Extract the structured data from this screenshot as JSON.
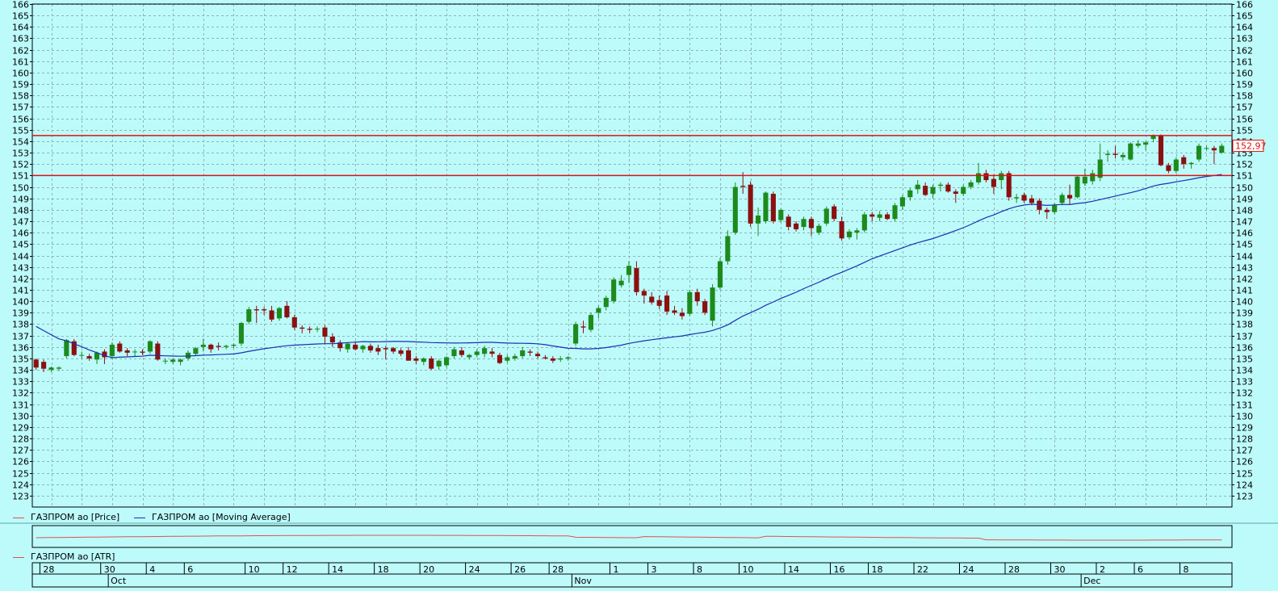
{
  "legend": {
    "price": "ГАЗПРОМ ао [Price]",
    "ma": "ГАЗПРОМ ао [Moving Average]",
    "atr": "ГАЗПРОМ ао [ATR]"
  },
  "colors": {
    "background": "#bdfbfb",
    "up": "#1c8b1c",
    "down": "#8b1010",
    "ma": "#1c2fb0",
    "level": "#e01010",
    "atr": "#e05050"
  },
  "chart_data": {
    "type": "candlestick",
    "ylim": [
      122,
      166
    ],
    "ticks": [
      123,
      124,
      125,
      126,
      127,
      128,
      129,
      130,
      131,
      132,
      133,
      134,
      135,
      136,
      137,
      138,
      139,
      140,
      141,
      142,
      143,
      144,
      145,
      146,
      147,
      148,
      149,
      150,
      151,
      152,
      153,
      154,
      155,
      156,
      157,
      158,
      159,
      160,
      161,
      162,
      163,
      164,
      165,
      166
    ],
    "last_price": "152,97",
    "levels": [
      154.5,
      151.0
    ],
    "x_day_labels": [
      "28",
      "30",
      "4",
      "6",
      "10",
      "12",
      "14",
      "18",
      "20",
      "24",
      "26",
      "28",
      "1",
      "3",
      "8",
      "10",
      "14",
      "16",
      "18",
      "22",
      "24",
      "28",
      "30",
      "2",
      "6",
      "8"
    ],
    "x_month_labels": [
      "Oct",
      "Nov",
      "Dec"
    ],
    "candles": [
      {
        "o": 134.9,
        "h": 135.0,
        "l": 134.0,
        "c": 134.2
      },
      {
        "o": 134.7,
        "h": 134.9,
        "l": 133.8,
        "c": 134.1
      },
      {
        "o": 134.0,
        "h": 134.3,
        "l": 133.8,
        "c": 134.2
      },
      {
        "o": 134.1,
        "h": 134.3,
        "l": 133.9,
        "c": 134.2
      },
      {
        "o": 135.2,
        "h": 136.7,
        "l": 135.0,
        "c": 136.6
      },
      {
        "o": 136.5,
        "h": 136.7,
        "l": 135.2,
        "c": 135.3
      },
      {
        "o": 135.3,
        "h": 135.6,
        "l": 135.0,
        "c": 135.3
      },
      {
        "o": 135.2,
        "h": 135.4,
        "l": 134.8,
        "c": 135.0
      },
      {
        "o": 134.9,
        "h": 135.6,
        "l": 134.5,
        "c": 135.5
      },
      {
        "o": 135.6,
        "h": 135.8,
        "l": 134.5,
        "c": 135.1
      },
      {
        "o": 135.2,
        "h": 136.4,
        "l": 135.0,
        "c": 136.2
      },
      {
        "o": 136.3,
        "h": 136.5,
        "l": 135.5,
        "c": 135.6
      },
      {
        "o": 135.7,
        "h": 135.9,
        "l": 135.2,
        "c": 135.5
      },
      {
        "o": 135.6,
        "h": 135.8,
        "l": 135.2,
        "c": 135.6
      },
      {
        "o": 135.6,
        "h": 135.8,
        "l": 135.3,
        "c": 135.5
      },
      {
        "o": 135.6,
        "h": 136.6,
        "l": 135.4,
        "c": 136.5
      },
      {
        "o": 136.3,
        "h": 136.5,
        "l": 134.8,
        "c": 134.9
      },
      {
        "o": 134.8,
        "h": 135.0,
        "l": 134.5,
        "c": 134.8
      },
      {
        "o": 134.7,
        "h": 135.0,
        "l": 134.5,
        "c": 134.9
      },
      {
        "o": 134.7,
        "h": 135.0,
        "l": 134.4,
        "c": 134.9
      },
      {
        "o": 135.0,
        "h": 135.7,
        "l": 134.8,
        "c": 135.5
      },
      {
        "o": 135.4,
        "h": 136.0,
        "l": 135.2,
        "c": 135.9
      },
      {
        "o": 136.0,
        "h": 136.7,
        "l": 135.6,
        "c": 136.2
      },
      {
        "o": 136.2,
        "h": 136.3,
        "l": 135.5,
        "c": 135.8
      },
      {
        "o": 136.1,
        "h": 136.4,
        "l": 135.7,
        "c": 136.0
      },
      {
        "o": 136.0,
        "h": 136.2,
        "l": 135.8,
        "c": 136.1
      },
      {
        "o": 136.1,
        "h": 136.3,
        "l": 135.9,
        "c": 136.2
      },
      {
        "o": 136.3,
        "h": 138.2,
        "l": 136.1,
        "c": 138.1
      },
      {
        "o": 138.2,
        "h": 139.5,
        "l": 138.0,
        "c": 139.3
      },
      {
        "o": 139.3,
        "h": 139.6,
        "l": 138.1,
        "c": 139.2
      },
      {
        "o": 139.3,
        "h": 139.5,
        "l": 138.8,
        "c": 139.2
      },
      {
        "o": 139.2,
        "h": 139.6,
        "l": 138.2,
        "c": 138.4
      },
      {
        "o": 138.5,
        "h": 139.5,
        "l": 138.3,
        "c": 139.4
      },
      {
        "o": 139.6,
        "h": 140.0,
        "l": 138.5,
        "c": 138.6
      },
      {
        "o": 138.6,
        "h": 138.8,
        "l": 137.5,
        "c": 137.7
      },
      {
        "o": 137.7,
        "h": 137.9,
        "l": 137.2,
        "c": 137.6
      },
      {
        "o": 137.6,
        "h": 137.8,
        "l": 137.2,
        "c": 137.5
      },
      {
        "o": 137.6,
        "h": 137.8,
        "l": 137.3,
        "c": 137.6
      },
      {
        "o": 137.7,
        "h": 137.9,
        "l": 136.3,
        "c": 136.9
      },
      {
        "o": 136.9,
        "h": 137.2,
        "l": 136.0,
        "c": 136.4
      },
      {
        "o": 136.4,
        "h": 136.6,
        "l": 135.6,
        "c": 135.9
      },
      {
        "o": 135.8,
        "h": 136.4,
        "l": 135.5,
        "c": 136.3
      },
      {
        "o": 136.2,
        "h": 136.5,
        "l": 135.7,
        "c": 135.8
      },
      {
        "o": 135.8,
        "h": 136.2,
        "l": 135.5,
        "c": 136.1
      },
      {
        "o": 136.1,
        "h": 136.3,
        "l": 135.5,
        "c": 135.7
      },
      {
        "o": 135.9,
        "h": 136.2,
        "l": 135.3,
        "c": 135.6
      },
      {
        "o": 135.9,
        "h": 136.1,
        "l": 134.9,
        "c": 135.8
      },
      {
        "o": 135.9,
        "h": 136.0,
        "l": 135.4,
        "c": 135.6
      },
      {
        "o": 135.7,
        "h": 135.9,
        "l": 135.2,
        "c": 135.4
      },
      {
        "o": 135.7,
        "h": 136.0,
        "l": 135.0,
        "c": 134.8
      },
      {
        "o": 135.0,
        "h": 135.2,
        "l": 134.5,
        "c": 134.8
      },
      {
        "o": 134.7,
        "h": 135.1,
        "l": 134.4,
        "c": 135.0
      },
      {
        "o": 135.0,
        "h": 135.2,
        "l": 134.0,
        "c": 134.1
      },
      {
        "o": 134.3,
        "h": 134.9,
        "l": 134.0,
        "c": 134.8
      },
      {
        "o": 134.4,
        "h": 135.2,
        "l": 134.2,
        "c": 135.1
      },
      {
        "o": 135.2,
        "h": 136.0,
        "l": 135.0,
        "c": 135.8
      },
      {
        "o": 135.7,
        "h": 136.0,
        "l": 135.1,
        "c": 135.3
      },
      {
        "o": 135.1,
        "h": 135.4,
        "l": 134.9,
        "c": 135.3
      },
      {
        "o": 135.3,
        "h": 135.8,
        "l": 135.1,
        "c": 135.6
      },
      {
        "o": 135.4,
        "h": 136.1,
        "l": 135.1,
        "c": 135.9
      },
      {
        "o": 135.6,
        "h": 135.9,
        "l": 135.1,
        "c": 135.4
      },
      {
        "o": 135.3,
        "h": 135.5,
        "l": 134.5,
        "c": 134.6
      },
      {
        "o": 134.8,
        "h": 135.3,
        "l": 134.6,
        "c": 135.1
      },
      {
        "o": 135.0,
        "h": 135.4,
        "l": 134.8,
        "c": 135.2
      },
      {
        "o": 135.2,
        "h": 136.0,
        "l": 135.0,
        "c": 135.7
      },
      {
        "o": 135.6,
        "h": 135.8,
        "l": 135.2,
        "c": 135.5
      },
      {
        "o": 135.4,
        "h": 135.6,
        "l": 135.0,
        "c": 135.2
      },
      {
        "o": 135.1,
        "h": 135.3,
        "l": 134.9,
        "c": 135.0
      },
      {
        "o": 135.0,
        "h": 135.2,
        "l": 134.6,
        "c": 134.8
      },
      {
        "o": 134.9,
        "h": 135.2,
        "l": 134.7,
        "c": 135.0
      },
      {
        "o": 135.0,
        "h": 135.2,
        "l": 134.8,
        "c": 135.1
      },
      {
        "o": 136.3,
        "h": 138.2,
        "l": 136.1,
        "c": 138.0
      },
      {
        "o": 137.8,
        "h": 138.3,
        "l": 137.2,
        "c": 137.7
      },
      {
        "o": 137.5,
        "h": 139.0,
        "l": 137.3,
        "c": 138.8
      },
      {
        "o": 139.0,
        "h": 139.6,
        "l": 138.5,
        "c": 139.4
      },
      {
        "o": 139.5,
        "h": 140.5,
        "l": 139.2,
        "c": 140.3
      },
      {
        "o": 140.0,
        "h": 142.1,
        "l": 139.8,
        "c": 141.9
      },
      {
        "o": 141.4,
        "h": 142.3,
        "l": 141.2,
        "c": 141.8
      },
      {
        "o": 142.3,
        "h": 143.5,
        "l": 141.6,
        "c": 143.1
      },
      {
        "o": 142.9,
        "h": 143.5,
        "l": 140.5,
        "c": 140.8
      },
      {
        "o": 140.9,
        "h": 141.1,
        "l": 139.8,
        "c": 140.5
      },
      {
        "o": 140.4,
        "h": 140.8,
        "l": 139.7,
        "c": 139.9
      },
      {
        "o": 140.1,
        "h": 140.5,
        "l": 139.3,
        "c": 139.6
      },
      {
        "o": 140.5,
        "h": 140.9,
        "l": 138.8,
        "c": 139.1
      },
      {
        "o": 139.2,
        "h": 139.6,
        "l": 138.8,
        "c": 139.0
      },
      {
        "o": 139.0,
        "h": 139.4,
        "l": 138.4,
        "c": 138.7
      },
      {
        "o": 138.9,
        "h": 141.0,
        "l": 138.7,
        "c": 140.8
      },
      {
        "o": 140.8,
        "h": 141.1,
        "l": 139.6,
        "c": 140.0
      },
      {
        "o": 140.0,
        "h": 140.2,
        "l": 138.8,
        "c": 139.0
      },
      {
        "o": 138.3,
        "h": 141.5,
        "l": 137.8,
        "c": 141.2
      },
      {
        "o": 141.2,
        "h": 143.8,
        "l": 141.0,
        "c": 143.5
      },
      {
        "o": 143.5,
        "h": 146.2,
        "l": 143.2,
        "c": 145.7
      },
      {
        "o": 146.0,
        "h": 150.4,
        "l": 145.8,
        "c": 150.0
      },
      {
        "o": 150.1,
        "h": 151.3,
        "l": 149.4,
        "c": 150.0
      },
      {
        "o": 150.2,
        "h": 150.5,
        "l": 146.5,
        "c": 146.8
      },
      {
        "o": 146.8,
        "h": 148.2,
        "l": 145.7,
        "c": 147.5
      },
      {
        "o": 147.0,
        "h": 149.6,
        "l": 146.8,
        "c": 149.5
      },
      {
        "o": 149.4,
        "h": 149.6,
        "l": 146.8,
        "c": 147.0
      },
      {
        "o": 147.1,
        "h": 148.1,
        "l": 146.9,
        "c": 148.0
      },
      {
        "o": 147.4,
        "h": 147.6,
        "l": 146.2,
        "c": 146.5
      },
      {
        "o": 146.8,
        "h": 147.0,
        "l": 146.1,
        "c": 146.3
      },
      {
        "o": 146.5,
        "h": 147.4,
        "l": 146.2,
        "c": 147.2
      },
      {
        "o": 147.2,
        "h": 147.4,
        "l": 145.7,
        "c": 146.4
      },
      {
        "o": 146.0,
        "h": 146.8,
        "l": 145.8,
        "c": 146.6
      },
      {
        "o": 146.8,
        "h": 148.3,
        "l": 146.6,
        "c": 148.1
      },
      {
        "o": 148.3,
        "h": 148.5,
        "l": 147.0,
        "c": 147.2
      },
      {
        "o": 147.0,
        "h": 147.4,
        "l": 145.3,
        "c": 145.5
      },
      {
        "o": 145.6,
        "h": 146.3,
        "l": 145.4,
        "c": 146.1
      },
      {
        "o": 146.0,
        "h": 146.4,
        "l": 145.4,
        "c": 146.2
      },
      {
        "o": 146.2,
        "h": 147.8,
        "l": 146.0,
        "c": 147.6
      },
      {
        "o": 147.6,
        "h": 147.8,
        "l": 147.0,
        "c": 147.4
      },
      {
        "o": 147.3,
        "h": 147.9,
        "l": 147.0,
        "c": 147.6
      },
      {
        "o": 147.6,
        "h": 147.8,
        "l": 147.1,
        "c": 147.2
      },
      {
        "o": 147.2,
        "h": 148.6,
        "l": 147.0,
        "c": 148.4
      },
      {
        "o": 148.3,
        "h": 149.3,
        "l": 148.0,
        "c": 149.1
      },
      {
        "o": 149.1,
        "h": 149.9,
        "l": 148.8,
        "c": 149.7
      },
      {
        "o": 149.8,
        "h": 150.6,
        "l": 149.4,
        "c": 150.2
      },
      {
        "o": 150.1,
        "h": 150.4,
        "l": 149.2,
        "c": 149.3
      },
      {
        "o": 149.4,
        "h": 150.2,
        "l": 149.0,
        "c": 150.0
      },
      {
        "o": 150.1,
        "h": 150.4,
        "l": 149.6,
        "c": 150.2
      },
      {
        "o": 150.2,
        "h": 150.4,
        "l": 149.5,
        "c": 149.6
      },
      {
        "o": 149.6,
        "h": 149.8,
        "l": 148.6,
        "c": 149.4
      },
      {
        "o": 149.4,
        "h": 150.2,
        "l": 149.2,
        "c": 150.0
      },
      {
        "o": 150.0,
        "h": 150.6,
        "l": 149.8,
        "c": 150.4
      },
      {
        "o": 150.4,
        "h": 152.1,
        "l": 150.2,
        "c": 151.2
      },
      {
        "o": 151.2,
        "h": 151.5,
        "l": 150.4,
        "c": 150.6
      },
      {
        "o": 150.7,
        "h": 151.1,
        "l": 149.4,
        "c": 150.0
      },
      {
        "o": 150.6,
        "h": 151.4,
        "l": 149.8,
        "c": 151.2
      },
      {
        "o": 151.2,
        "h": 151.4,
        "l": 148.8,
        "c": 149.1
      },
      {
        "o": 149.0,
        "h": 149.4,
        "l": 148.6,
        "c": 149.1
      },
      {
        "o": 149.3,
        "h": 149.5,
        "l": 148.6,
        "c": 148.8
      },
      {
        "o": 149.0,
        "h": 149.3,
        "l": 148.4,
        "c": 148.6
      },
      {
        "o": 148.8,
        "h": 149.0,
        "l": 147.6,
        "c": 148.0
      },
      {
        "o": 148.0,
        "h": 148.2,
        "l": 147.2,
        "c": 147.8
      },
      {
        "o": 147.8,
        "h": 148.6,
        "l": 147.6,
        "c": 148.4
      },
      {
        "o": 148.6,
        "h": 149.5,
        "l": 148.4,
        "c": 149.3
      },
      {
        "o": 149.3,
        "h": 150.2,
        "l": 148.5,
        "c": 149.0
      },
      {
        "o": 149.1,
        "h": 151.0,
        "l": 149.0,
        "c": 150.9
      },
      {
        "o": 150.3,
        "h": 151.6,
        "l": 150.1,
        "c": 150.9
      },
      {
        "o": 150.5,
        "h": 151.5,
        "l": 150.2,
        "c": 151.2
      },
      {
        "o": 150.8,
        "h": 153.8,
        "l": 150.5,
        "c": 152.4
      },
      {
        "o": 152.8,
        "h": 153.2,
        "l": 152.2,
        "c": 152.9
      },
      {
        "o": 152.9,
        "h": 153.6,
        "l": 152.5,
        "c": 152.8
      },
      {
        "o": 152.6,
        "h": 153.0,
        "l": 152.3,
        "c": 152.8
      },
      {
        "o": 152.4,
        "h": 153.9,
        "l": 152.3,
        "c": 153.8
      },
      {
        "o": 153.6,
        "h": 154.1,
        "l": 153.4,
        "c": 153.8
      },
      {
        "o": 153.7,
        "h": 154.0,
        "l": 153.2,
        "c": 153.9
      },
      {
        "o": 154.2,
        "h": 154.6,
        "l": 153.9,
        "c": 154.5
      },
      {
        "o": 154.5,
        "h": 154.6,
        "l": 151.8,
        "c": 151.9
      },
      {
        "o": 151.9,
        "h": 152.1,
        "l": 151.2,
        "c": 151.4
      },
      {
        "o": 151.4,
        "h": 152.6,
        "l": 151.2,
        "c": 152.4
      },
      {
        "o": 152.6,
        "h": 152.8,
        "l": 151.6,
        "c": 152.0
      },
      {
        "o": 152.0,
        "h": 152.2,
        "l": 151.6,
        "c": 152.1
      },
      {
        "o": 152.4,
        "h": 153.8,
        "l": 152.2,
        "c": 153.6
      },
      {
        "o": 153.4,
        "h": 153.6,
        "l": 153.2,
        "c": 153.4
      },
      {
        "o": 153.4,
        "h": 153.6,
        "l": 152.0,
        "c": 153.2
      },
      {
        "o": 153.0,
        "h": 153.8,
        "l": 152.9,
        "c": 153.6
      }
    ]
  }
}
